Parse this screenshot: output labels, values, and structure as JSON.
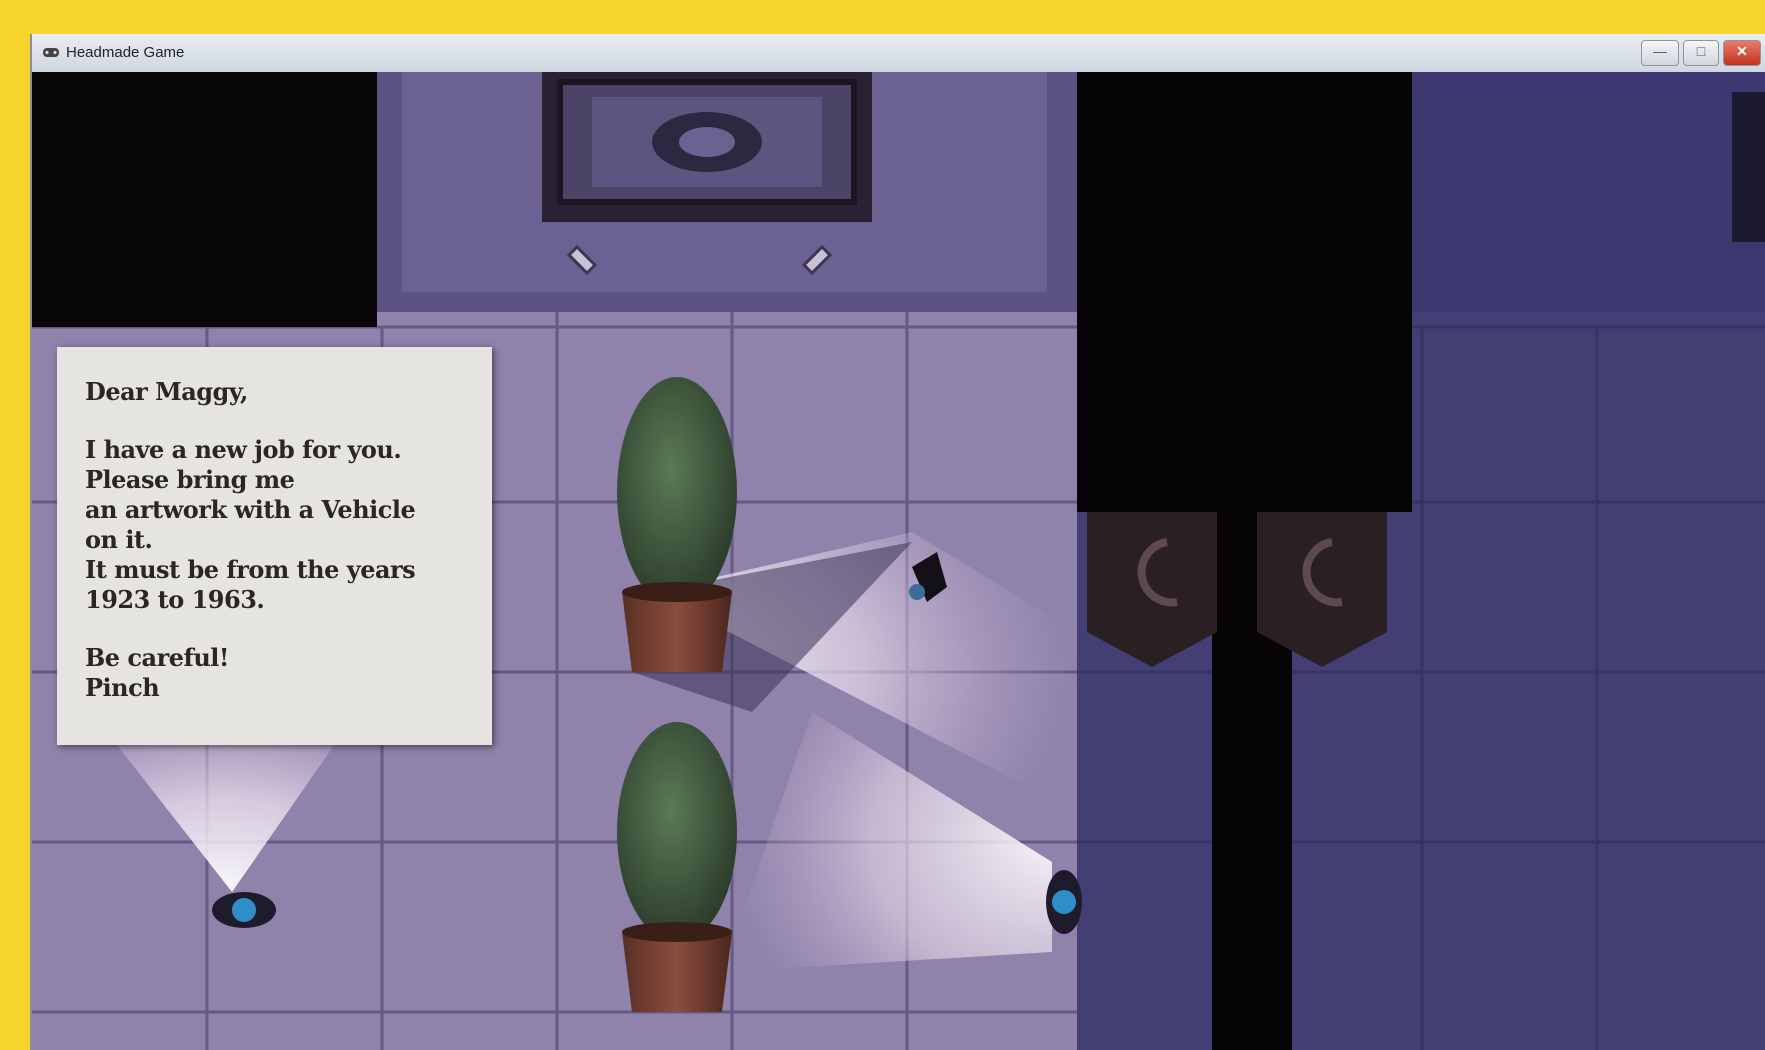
{
  "window": {
    "title": "Headmade Game",
    "min_symbol": "—",
    "max_symbol": "□",
    "close_symbol": "✕"
  },
  "letter": {
    "salutation": "Dear Maggy,",
    "line1": "I have a new job for you.",
    "line2": "Please bring me",
    "line3": "an artwork with a Vehicle",
    "line4": "on it.",
    "line5": "It must be from the years",
    "line6": "1923 to 1963.",
    "line7": "Be careful!",
    "signature": "Pinch"
  },
  "colors": {
    "frame_border": "#f6d42c",
    "floor_lit": "#b9a7c4",
    "floor_shadow": "#3e3a66",
    "note_paper": "#e6e4e0"
  },
  "icons": {
    "app": "game-controller-icon",
    "minimize": "minimize-icon",
    "maximize": "maximize-icon",
    "close": "close-icon"
  }
}
